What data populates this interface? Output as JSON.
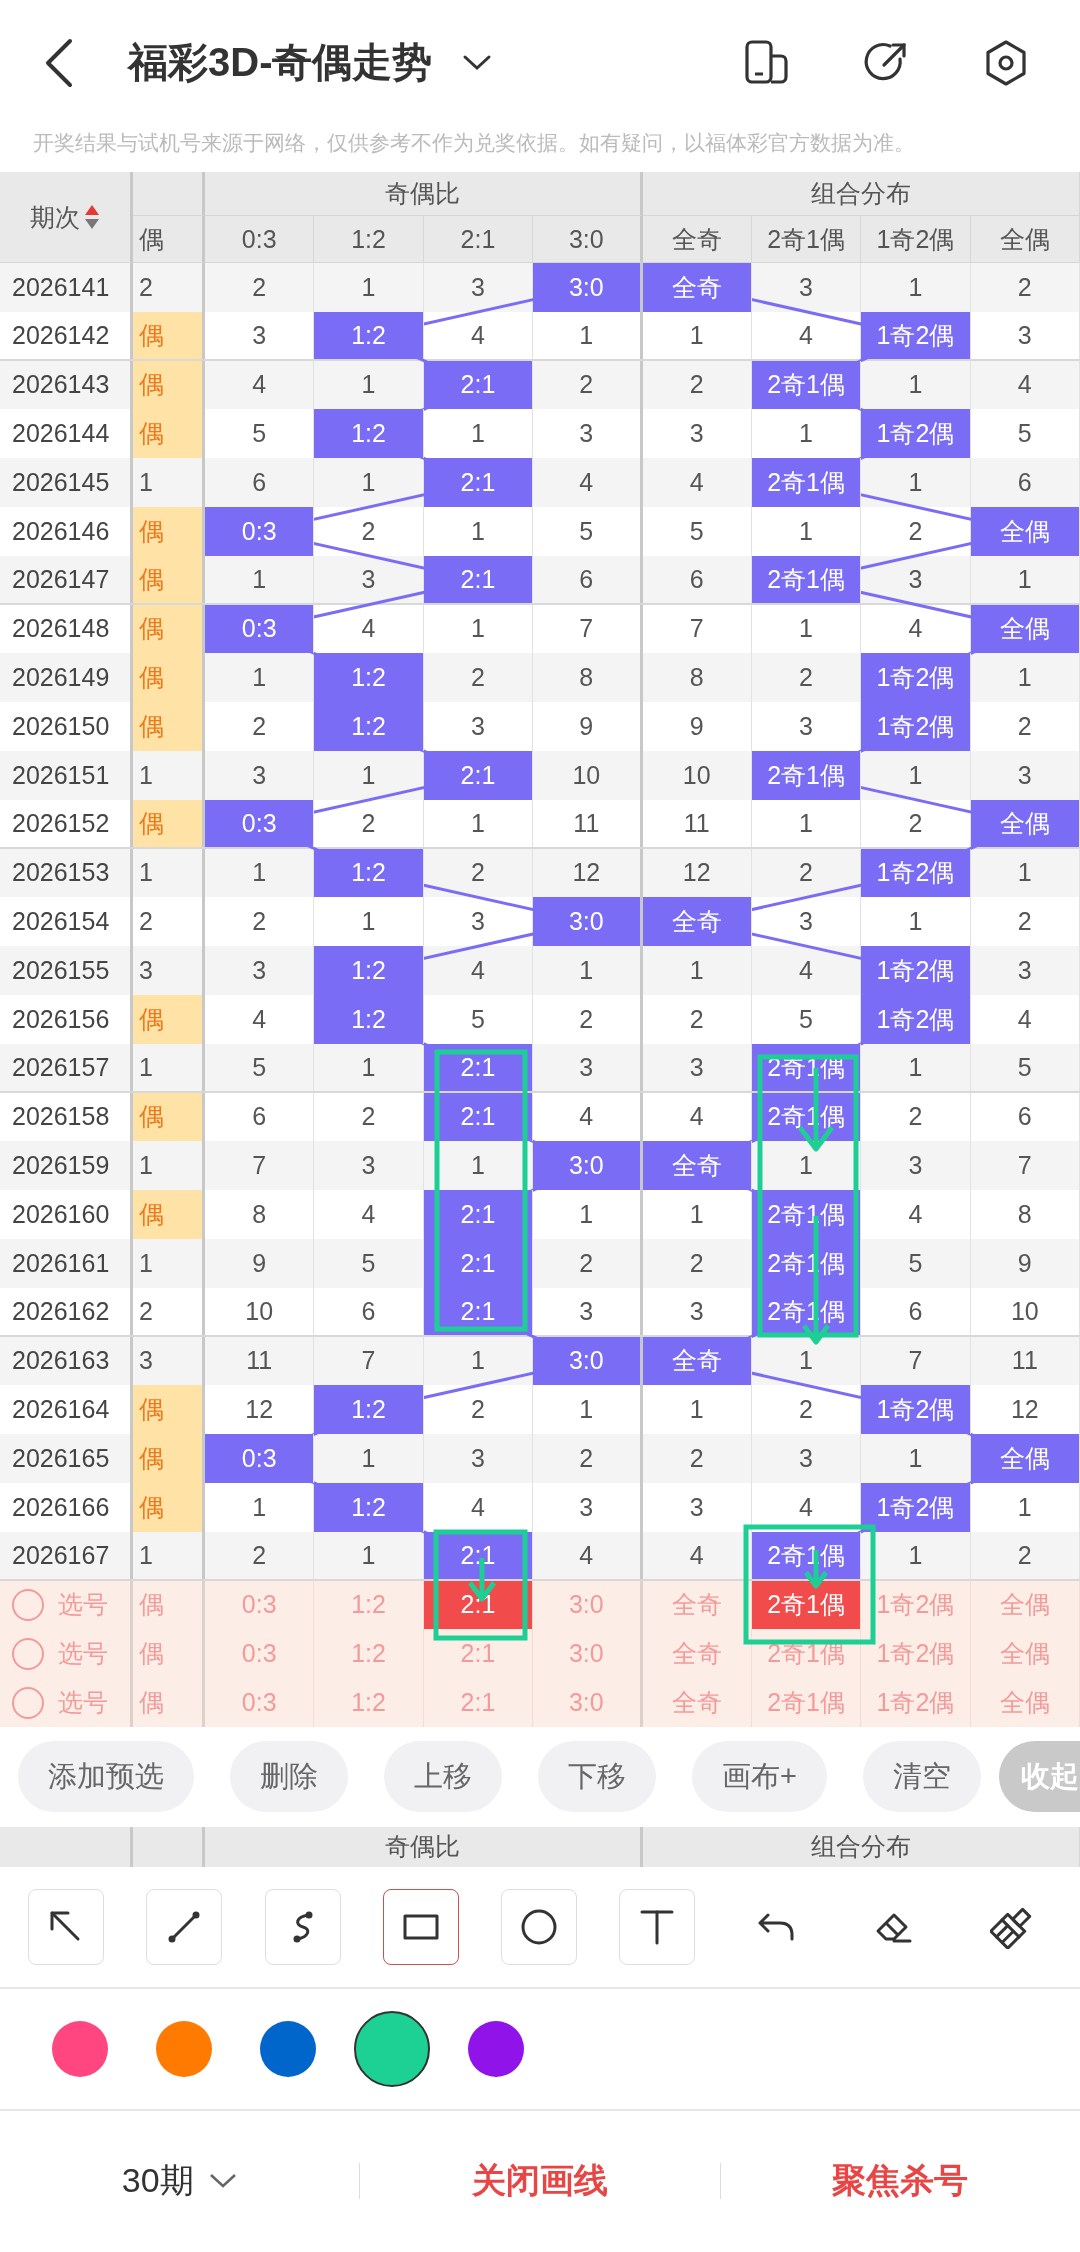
{
  "nav": {
    "title": "福彩3D-奇偶走势",
    "notice": "开奖结果与试机号来源于网络，仅供参考不作为兑奖依据。如有疑问，以福体彩官方数据为准。"
  },
  "table": {
    "period_header": "期次",
    "groups": [
      "奇偶比",
      "组合分布"
    ],
    "columns": [
      "偶",
      "0:3",
      "1:2",
      "2:1",
      "3:0",
      "全奇",
      "2奇1偶",
      "1奇2偶",
      "全偶"
    ],
    "rows": [
      {
        "period": "2026141",
        "cells": [
          {
            "text": "2",
            "hit": false
          },
          {
            "text": "2",
            "hit": false
          },
          {
            "text": "1",
            "hit": false
          },
          {
            "text": "3",
            "hit": false
          },
          {
            "text": "3:0",
            "hit": true
          },
          {
            "text": "全奇",
            "hit": true
          },
          {
            "text": "3",
            "hit": false
          },
          {
            "text": "1",
            "hit": false
          },
          {
            "text": "2",
            "hit": false
          }
        ]
      },
      {
        "period": "2026142",
        "cells": [
          {
            "text": "偶",
            "hit": true
          },
          {
            "text": "3",
            "hit": false
          },
          {
            "text": "1:2",
            "hit": true
          },
          {
            "text": "4",
            "hit": false
          },
          {
            "text": "1",
            "hit": false
          },
          {
            "text": "1",
            "hit": false
          },
          {
            "text": "4",
            "hit": false
          },
          {
            "text": "1奇2偶",
            "hit": true
          },
          {
            "text": "3",
            "hit": false
          }
        ]
      },
      {
        "period": "2026143",
        "cells": [
          {
            "text": "偶",
            "hit": true
          },
          {
            "text": "4",
            "hit": false
          },
          {
            "text": "1",
            "hit": false
          },
          {
            "text": "2:1",
            "hit": true
          },
          {
            "text": "2",
            "hit": false
          },
          {
            "text": "2",
            "hit": false
          },
          {
            "text": "2奇1偶",
            "hit": true
          },
          {
            "text": "1",
            "hit": false
          },
          {
            "text": "4",
            "hit": false
          }
        ]
      },
      {
        "period": "2026144",
        "cells": [
          {
            "text": "偶",
            "hit": true
          },
          {
            "text": "5",
            "hit": false
          },
          {
            "text": "1:2",
            "hit": true
          },
          {
            "text": "1",
            "hit": false
          },
          {
            "text": "3",
            "hit": false
          },
          {
            "text": "3",
            "hit": false
          },
          {
            "text": "1",
            "hit": false
          },
          {
            "text": "1奇2偶",
            "hit": true
          },
          {
            "text": "5",
            "hit": false
          }
        ]
      },
      {
        "period": "2026145",
        "cells": [
          {
            "text": "1",
            "hit": false
          },
          {
            "text": "6",
            "hit": false
          },
          {
            "text": "1",
            "hit": false
          },
          {
            "text": "2:1",
            "hit": true
          },
          {
            "text": "4",
            "hit": false
          },
          {
            "text": "4",
            "hit": false
          },
          {
            "text": "2奇1偶",
            "hit": true
          },
          {
            "text": "1",
            "hit": false
          },
          {
            "text": "6",
            "hit": false
          }
        ]
      },
      {
        "period": "2026146",
        "cells": [
          {
            "text": "偶",
            "hit": true
          },
          {
            "text": "0:3",
            "hit": true
          },
          {
            "text": "2",
            "hit": false
          },
          {
            "text": "1",
            "hit": false
          },
          {
            "text": "5",
            "hit": false
          },
          {
            "text": "5",
            "hit": false
          },
          {
            "text": "1",
            "hit": false
          },
          {
            "text": "2",
            "hit": false
          },
          {
            "text": "全偶",
            "hit": true
          }
        ]
      },
      {
        "period": "2026147",
        "cells": [
          {
            "text": "偶",
            "hit": true
          },
          {
            "text": "1",
            "hit": false
          },
          {
            "text": "3",
            "hit": false
          },
          {
            "text": "2:1",
            "hit": true
          },
          {
            "text": "6",
            "hit": false
          },
          {
            "text": "6",
            "hit": false
          },
          {
            "text": "2奇1偶",
            "hit": true
          },
          {
            "text": "3",
            "hit": false
          },
          {
            "text": "1",
            "hit": false
          }
        ]
      },
      {
        "period": "2026148",
        "cells": [
          {
            "text": "偶",
            "hit": true
          },
          {
            "text": "0:3",
            "hit": true
          },
          {
            "text": "4",
            "hit": false
          },
          {
            "text": "1",
            "hit": false
          },
          {
            "text": "7",
            "hit": false
          },
          {
            "text": "7",
            "hit": false
          },
          {
            "text": "1",
            "hit": false
          },
          {
            "text": "4",
            "hit": false
          },
          {
            "text": "全偶",
            "hit": true
          }
        ]
      },
      {
        "period": "2026149",
        "cells": [
          {
            "text": "偶",
            "hit": true
          },
          {
            "text": "1",
            "hit": false
          },
          {
            "text": "1:2",
            "hit": true
          },
          {
            "text": "2",
            "hit": false
          },
          {
            "text": "8",
            "hit": false
          },
          {
            "text": "8",
            "hit": false
          },
          {
            "text": "2",
            "hit": false
          },
          {
            "text": "1奇2偶",
            "hit": true
          },
          {
            "text": "1",
            "hit": false
          }
        ]
      },
      {
        "period": "2026150",
        "cells": [
          {
            "text": "偶",
            "hit": true
          },
          {
            "text": "2",
            "hit": false
          },
          {
            "text": "1:2",
            "hit": true
          },
          {
            "text": "3",
            "hit": false
          },
          {
            "text": "9",
            "hit": false
          },
          {
            "text": "9",
            "hit": false
          },
          {
            "text": "3",
            "hit": false
          },
          {
            "text": "1奇2偶",
            "hit": true
          },
          {
            "text": "2",
            "hit": false
          }
        ]
      },
      {
        "period": "2026151",
        "cells": [
          {
            "text": "1",
            "hit": false
          },
          {
            "text": "3",
            "hit": false
          },
          {
            "text": "1",
            "hit": false
          },
          {
            "text": "2:1",
            "hit": true
          },
          {
            "text": "10",
            "hit": false
          },
          {
            "text": "10",
            "hit": false
          },
          {
            "text": "2奇1偶",
            "hit": true
          },
          {
            "text": "1",
            "hit": false
          },
          {
            "text": "3",
            "hit": false
          }
        ]
      },
      {
        "period": "2026152",
        "cells": [
          {
            "text": "偶",
            "hit": true
          },
          {
            "text": "0:3",
            "hit": true
          },
          {
            "text": "2",
            "hit": false
          },
          {
            "text": "1",
            "hit": false
          },
          {
            "text": "11",
            "hit": false
          },
          {
            "text": "11",
            "hit": false
          },
          {
            "text": "1",
            "hit": false
          },
          {
            "text": "2",
            "hit": false
          },
          {
            "text": "全偶",
            "hit": true
          }
        ]
      },
      {
        "period": "2026153",
        "cells": [
          {
            "text": "1",
            "hit": false
          },
          {
            "text": "1",
            "hit": false
          },
          {
            "text": "1:2",
            "hit": true
          },
          {
            "text": "2",
            "hit": false
          },
          {
            "text": "12",
            "hit": false
          },
          {
            "text": "12",
            "hit": false
          },
          {
            "text": "2",
            "hit": false
          },
          {
            "text": "1奇2偶",
            "hit": true
          },
          {
            "text": "1",
            "hit": false
          }
        ]
      },
      {
        "period": "2026154",
        "cells": [
          {
            "text": "2",
            "hit": false
          },
          {
            "text": "2",
            "hit": false
          },
          {
            "text": "1",
            "hit": false
          },
          {
            "text": "3",
            "hit": false
          },
          {
            "text": "3:0",
            "hit": true
          },
          {
            "text": "全奇",
            "hit": true
          },
          {
            "text": "3",
            "hit": false
          },
          {
            "text": "1",
            "hit": false
          },
          {
            "text": "2",
            "hit": false
          }
        ]
      },
      {
        "period": "2026155",
        "cells": [
          {
            "text": "3",
            "hit": false
          },
          {
            "text": "3",
            "hit": false
          },
          {
            "text": "1:2",
            "hit": true
          },
          {
            "text": "4",
            "hit": false
          },
          {
            "text": "1",
            "hit": false
          },
          {
            "text": "1",
            "hit": false
          },
          {
            "text": "4",
            "hit": false
          },
          {
            "text": "1奇2偶",
            "hit": true
          },
          {
            "text": "3",
            "hit": false
          }
        ]
      },
      {
        "period": "2026156",
        "cells": [
          {
            "text": "偶",
            "hit": true
          },
          {
            "text": "4",
            "hit": false
          },
          {
            "text": "1:2",
            "hit": true
          },
          {
            "text": "5",
            "hit": false
          },
          {
            "text": "2",
            "hit": false
          },
          {
            "text": "2",
            "hit": false
          },
          {
            "text": "5",
            "hit": false
          },
          {
            "text": "1奇2偶",
            "hit": true
          },
          {
            "text": "4",
            "hit": false
          }
        ]
      },
      {
        "period": "2026157",
        "cells": [
          {
            "text": "1",
            "hit": false
          },
          {
            "text": "5",
            "hit": false
          },
          {
            "text": "1",
            "hit": false
          },
          {
            "text": "2:1",
            "hit": true
          },
          {
            "text": "3",
            "hit": false
          },
          {
            "text": "3",
            "hit": false
          },
          {
            "text": "2奇1偶",
            "hit": true
          },
          {
            "text": "1",
            "hit": false
          },
          {
            "text": "5",
            "hit": false
          }
        ]
      },
      {
        "period": "2026158",
        "cells": [
          {
            "text": "偶",
            "hit": true
          },
          {
            "text": "6",
            "hit": false
          },
          {
            "text": "2",
            "hit": false
          },
          {
            "text": "2:1",
            "hit": true
          },
          {
            "text": "4",
            "hit": false
          },
          {
            "text": "4",
            "hit": false
          },
          {
            "text": "2奇1偶",
            "hit": true
          },
          {
            "text": "2",
            "hit": false
          },
          {
            "text": "6",
            "hit": false
          }
        ]
      },
      {
        "period": "2026159",
        "cells": [
          {
            "text": "1",
            "hit": false
          },
          {
            "text": "7",
            "hit": false
          },
          {
            "text": "3",
            "hit": false
          },
          {
            "text": "1",
            "hit": false
          },
          {
            "text": "3:0",
            "hit": true
          },
          {
            "text": "全奇",
            "hit": true
          },
          {
            "text": "1",
            "hit": false
          },
          {
            "text": "3",
            "hit": false
          },
          {
            "text": "7",
            "hit": false
          }
        ]
      },
      {
        "period": "2026160",
        "cells": [
          {
            "text": "偶",
            "hit": true
          },
          {
            "text": "8",
            "hit": false
          },
          {
            "text": "4",
            "hit": false
          },
          {
            "text": "2:1",
            "hit": true
          },
          {
            "text": "1",
            "hit": false
          },
          {
            "text": "1",
            "hit": false
          },
          {
            "text": "2奇1偶",
            "hit": true
          },
          {
            "text": "4",
            "hit": false
          },
          {
            "text": "8",
            "hit": false
          }
        ]
      },
      {
        "period": "2026161",
        "cells": [
          {
            "text": "1",
            "hit": false
          },
          {
            "text": "9",
            "hit": false
          },
          {
            "text": "5",
            "hit": false
          },
          {
            "text": "2:1",
            "hit": true
          },
          {
            "text": "2",
            "hit": false
          },
          {
            "text": "2",
            "hit": false
          },
          {
            "text": "2奇1偶",
            "hit": true
          },
          {
            "text": "5",
            "hit": false
          },
          {
            "text": "9",
            "hit": false
          }
        ]
      },
      {
        "period": "2026162",
        "cells": [
          {
            "text": "2",
            "hit": false
          },
          {
            "text": "10",
            "hit": false
          },
          {
            "text": "6",
            "hit": false
          },
          {
            "text": "2:1",
            "hit": true
          },
          {
            "text": "3",
            "hit": false
          },
          {
            "text": "3",
            "hit": false
          },
          {
            "text": "2奇1偶",
            "hit": true
          },
          {
            "text": "6",
            "hit": false
          },
          {
            "text": "10",
            "hit": false
          }
        ]
      },
      {
        "period": "2026163",
        "cells": [
          {
            "text": "3",
            "hit": false
          },
          {
            "text": "11",
            "hit": false
          },
          {
            "text": "7",
            "hit": false
          },
          {
            "text": "1",
            "hit": false
          },
          {
            "text": "3:0",
            "hit": true
          },
          {
            "text": "全奇",
            "hit": true
          },
          {
            "text": "1",
            "hit": false
          },
          {
            "text": "7",
            "hit": false
          },
          {
            "text": "11",
            "hit": false
          }
        ]
      },
      {
        "period": "2026164",
        "cells": [
          {
            "text": "偶",
            "hit": true
          },
          {
            "text": "12",
            "hit": false
          },
          {
            "text": "1:2",
            "hit": true
          },
          {
            "text": "2",
            "hit": false
          },
          {
            "text": "1",
            "hit": false
          },
          {
            "text": "1",
            "hit": false
          },
          {
            "text": "2",
            "hit": false
          },
          {
            "text": "1奇2偶",
            "hit": true
          },
          {
            "text": "12",
            "hit": false
          }
        ]
      },
      {
        "period": "2026165",
        "cells": [
          {
            "text": "偶",
            "hit": true
          },
          {
            "text": "0:3",
            "hit": true
          },
          {
            "text": "1",
            "hit": false
          },
          {
            "text": "3",
            "hit": false
          },
          {
            "text": "2",
            "hit": false
          },
          {
            "text": "2",
            "hit": false
          },
          {
            "text": "3",
            "hit": false
          },
          {
            "text": "1",
            "hit": false
          },
          {
            "text": "全偶",
            "hit": true
          }
        ]
      },
      {
        "period": "2026166",
        "cells": [
          {
            "text": "偶",
            "hit": true
          },
          {
            "text": "1",
            "hit": false
          },
          {
            "text": "1:2",
            "hit": true
          },
          {
            "text": "4",
            "hit": false
          },
          {
            "text": "3",
            "hit": false
          },
          {
            "text": "3",
            "hit": false
          },
          {
            "text": "4",
            "hit": false
          },
          {
            "text": "1奇2偶",
            "hit": true
          },
          {
            "text": "1",
            "hit": false
          }
        ]
      },
      {
        "period": "2026167",
        "cells": [
          {
            "text": "1",
            "hit": false
          },
          {
            "text": "2",
            "hit": false
          },
          {
            "text": "1",
            "hit": false
          },
          {
            "text": "2:1",
            "hit": true
          },
          {
            "text": "4",
            "hit": false
          },
          {
            "text": "4",
            "hit": false
          },
          {
            "text": "2奇1偶",
            "hit": true
          },
          {
            "text": "1",
            "hit": false
          },
          {
            "text": "2",
            "hit": false
          }
        ]
      }
    ],
    "pick_rows": [
      {
        "label": "选号",
        "checked": false,
        "cells": [
          {
            "text": "偶",
            "selected": false
          },
          {
            "text": "0:3",
            "selected": false
          },
          {
            "text": "1:2",
            "selected": false
          },
          {
            "text": "2:1",
            "selected": true
          },
          {
            "text": "3:0",
            "selected": false
          },
          {
            "text": "全奇",
            "selected": false
          },
          {
            "text": "2奇1偶",
            "selected": true
          },
          {
            "text": "1奇2偶",
            "selected": false
          },
          {
            "text": "全偶",
            "selected": false
          }
        ]
      },
      {
        "label": "选号",
        "checked": false,
        "cells": [
          {
            "text": "偶",
            "selected": false
          },
          {
            "text": "0:3",
            "selected": false
          },
          {
            "text": "1:2",
            "selected": false
          },
          {
            "text": "2:1",
            "selected": false
          },
          {
            "text": "3:0",
            "selected": false
          },
          {
            "text": "全奇",
            "selected": false
          },
          {
            "text": "2奇1偶",
            "selected": false
          },
          {
            "text": "1奇2偶",
            "selected": false
          },
          {
            "text": "全偶",
            "selected": false
          }
        ]
      },
      {
        "label": "选号",
        "checked": false,
        "cells": [
          {
            "text": "偶",
            "selected": false
          },
          {
            "text": "0:3",
            "selected": false
          },
          {
            "text": "1:2",
            "selected": false
          },
          {
            "text": "2:1",
            "selected": false
          },
          {
            "text": "3:0",
            "selected": false
          },
          {
            "text": "全奇",
            "selected": false
          },
          {
            "text": "2奇1偶",
            "selected": false
          },
          {
            "text": "1奇2偶",
            "selected": false
          },
          {
            "text": "全偶",
            "selected": false
          }
        ]
      }
    ]
  },
  "canvas_drawings": [
    {
      "kind": "rect",
      "color": "#1dcf94"
    },
    {
      "kind": "rect",
      "color": "#1dcf94"
    },
    {
      "kind": "arrow",
      "color": "#1dcf94"
    },
    {
      "kind": "arrow",
      "color": "#1dcf94"
    },
    {
      "kind": "rect",
      "color": "#1dcf94"
    },
    {
      "kind": "arrow",
      "color": "#1dcf94"
    },
    {
      "kind": "rect",
      "color": "#1dcf94"
    },
    {
      "kind": "arrow",
      "color": "#1dcf94"
    }
  ],
  "actions": [
    {
      "label": "添加预选",
      "kind": "pill"
    },
    {
      "label": "删除",
      "kind": "pill"
    },
    {
      "label": "上移",
      "kind": "pill"
    },
    {
      "label": "下移",
      "kind": "pill"
    },
    {
      "label": "画布+",
      "kind": "pill"
    },
    {
      "label": "清空",
      "kind": "pill"
    },
    {
      "label": "收起",
      "kind": "collapse"
    }
  ],
  "sticky_header": {
    "groups": [
      "奇偶比",
      "组合分布"
    ]
  },
  "tools": [
    {
      "kind": "arrow",
      "selected": false
    },
    {
      "kind": "line",
      "selected": false
    },
    {
      "kind": "curve",
      "selected": false
    },
    {
      "kind": "rectangle",
      "selected": true
    },
    {
      "kind": "circle",
      "selected": false
    },
    {
      "kind": "text",
      "selected": false
    },
    {
      "kind": "undo",
      "selected": false
    },
    {
      "kind": "eraser",
      "selected": false
    },
    {
      "kind": "clear",
      "selected": false
    }
  ],
  "colors": [
    {
      "color": "#ff4680",
      "selected": false
    },
    {
      "color": "#ff7a00",
      "selected": false
    },
    {
      "color": "#0066cc",
      "selected": false
    },
    {
      "color": "#1dd194",
      "selected": true
    },
    {
      "color": "#9013ea",
      "selected": false
    }
  ],
  "bottom": {
    "period_select": "30期",
    "buttons": [
      "关闭画线",
      "聚焦杀号"
    ]
  }
}
